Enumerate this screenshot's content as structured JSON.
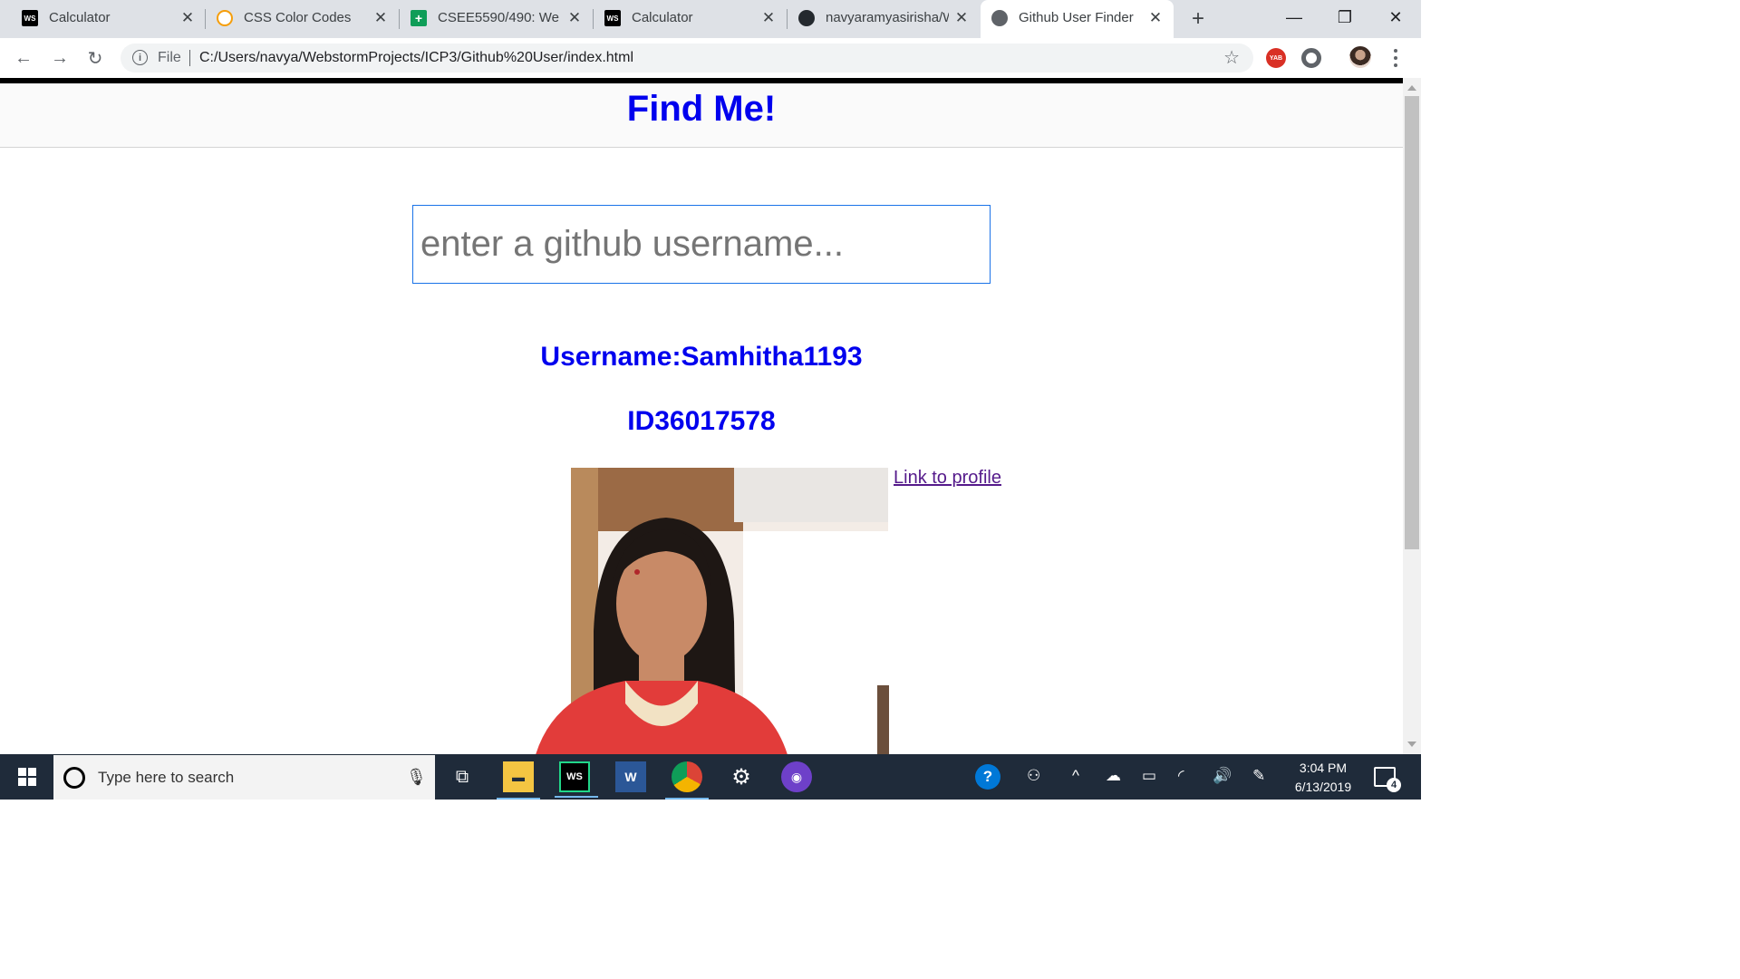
{
  "browser": {
    "tabs": [
      {
        "title": "Calculator",
        "favicon": "webstorm-icon",
        "active": false
      },
      {
        "title": "CSS Color Codes",
        "favicon": "search-icon",
        "active": false
      },
      {
        "title": "CSEE5590/490: Web/",
        "favicon": "sheets-icon",
        "active": false
      },
      {
        "title": "Calculator",
        "favicon": "webstorm-icon",
        "active": false
      },
      {
        "title": "navyaramyasirisha/W",
        "favicon": "github-icon",
        "active": false
      },
      {
        "title": "Github User Finder",
        "favicon": "globe-icon",
        "active": true
      }
    ],
    "address": {
      "scheme_label": "File",
      "url": "C:/Users/navya/WebstormProjects/ICP3/Github%20User/index.html"
    },
    "extensions": [
      {
        "name": "yab-icon",
        "label": "YAB",
        "color": "#d93025"
      },
      {
        "name": "extension-circle-icon",
        "label": "",
        "color": "#5f6368"
      }
    ]
  },
  "page": {
    "heading": "Find Me!",
    "search_placeholder": "enter a github username...",
    "username_text": "Username:Samhitha1193",
    "id_text": "ID36017578",
    "profile_link": "Link to profile",
    "colors": {
      "heading": "#0000ee",
      "link_visited": "#551a8b"
    }
  },
  "taskbar": {
    "search_placeholder": "Type here to search",
    "time": "3:04 PM",
    "date": "6/13/2019",
    "notification_count": "4"
  }
}
